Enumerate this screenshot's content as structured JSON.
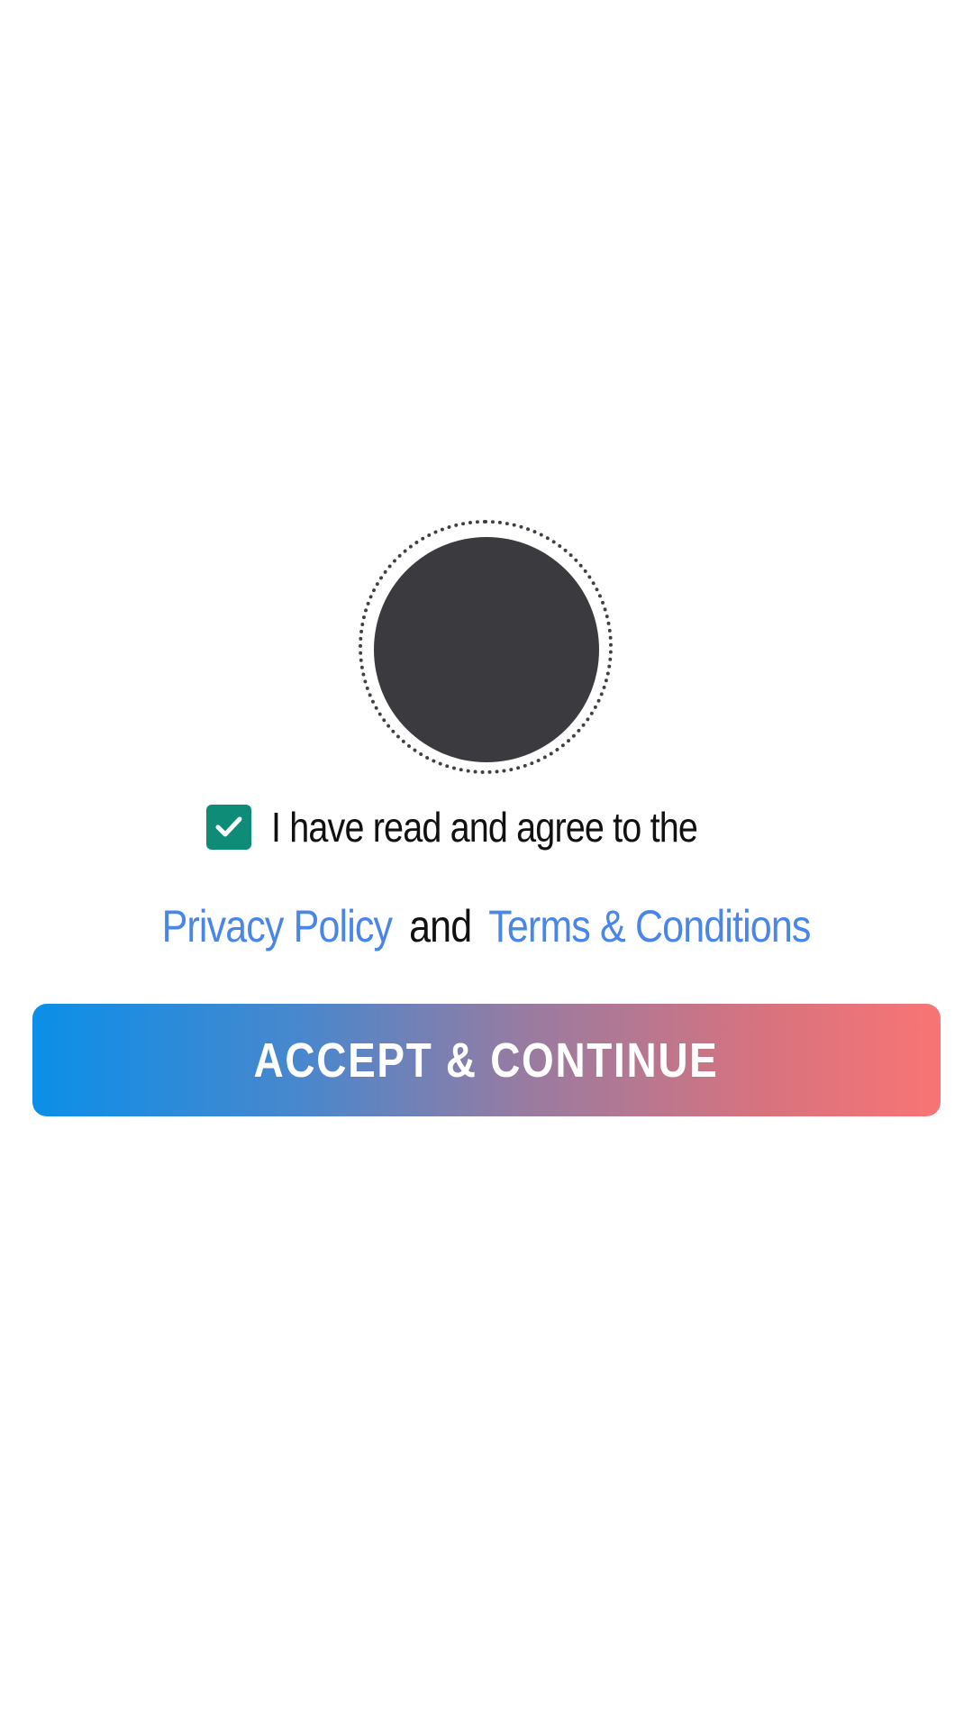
{
  "logo": {
    "icon": "app-logo-icon"
  },
  "consent": {
    "checked": true,
    "checkbox_icon": "checkmark-icon",
    "agree_text": "I have read and agree to the",
    "privacy_link": "Privacy Policy",
    "conjunction": "and",
    "terms_link": "Terms & Conditions"
  },
  "accept_button": {
    "label": "ACCEPT & CONTINUE"
  },
  "colors": {
    "checkbox": "#0f8c78",
    "link": "#4a86e8",
    "button_gradient_start": "#0b8fe8",
    "button_gradient_end": "#f97474",
    "logo": "#3b3a3f"
  }
}
